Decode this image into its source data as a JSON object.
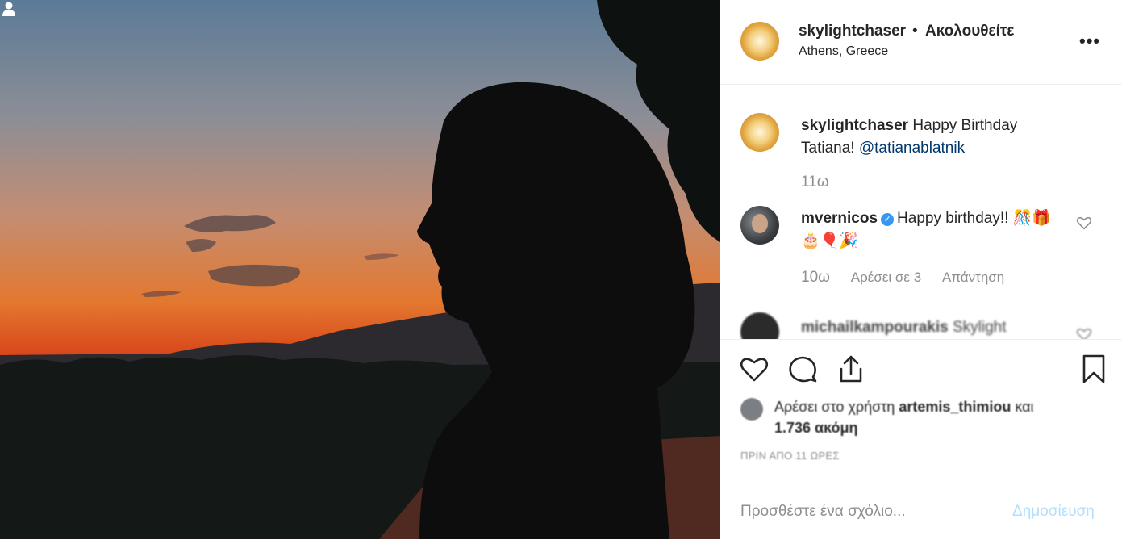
{
  "header": {
    "username": "skylightchaser",
    "separator": "•",
    "follow_status": "Ακολουθείτε",
    "location": "Athens, Greece",
    "more_icon": "more-options-icon"
  },
  "caption": {
    "username": "skylightchaser",
    "text": " Happy Birthday Tatiana! ",
    "mention": "@tatianablatnik",
    "time": "11ω"
  },
  "comments": [
    {
      "username": "mvernicos",
      "verified": true,
      "text": "Happy birthday!! 🎊🎁🎂🎈🎉",
      "time": "10ω",
      "likes": "Αρέσει σε 3",
      "reply": "Απάντηση"
    },
    {
      "username": "michailkampourakis",
      "text": "Skylight"
    }
  ],
  "likes": {
    "prefix": "Αρέσει στο χρήστη ",
    "user": "artemis_thimiou",
    "suffix": " και",
    "count": "1.736 ακόμη"
  },
  "timestamp": "ΠΡΙΝ ΑΠΟ 11 ΩΡΕΣ",
  "add_comment": {
    "placeholder": "Προσθέστε ένα σχόλιο...",
    "post_label": "Δημοσίευση"
  },
  "icons": {
    "like": "heart-icon",
    "comment": "comment-icon",
    "share": "share-icon",
    "save": "bookmark-icon",
    "photo_tags": "user-tag-icon"
  }
}
